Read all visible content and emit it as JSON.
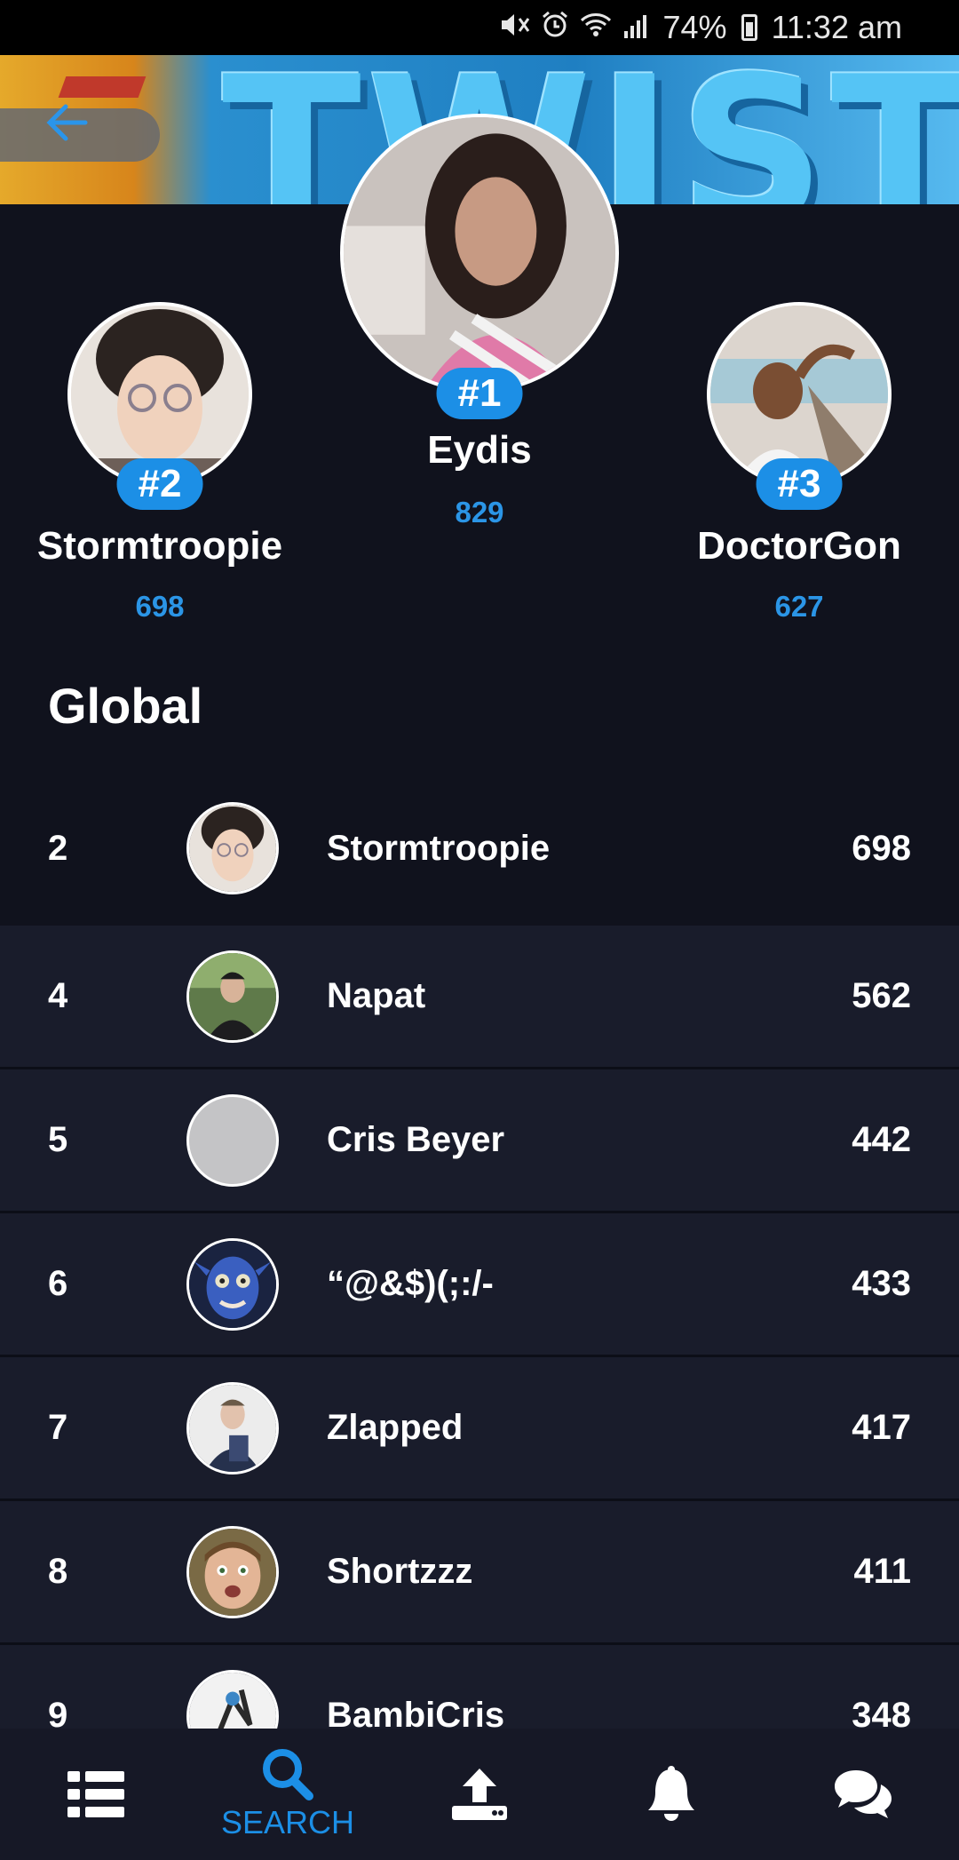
{
  "status_bar": {
    "battery": "74%",
    "time": "11:32 am"
  },
  "banner": {
    "text": "TWISTER"
  },
  "podium": [
    {
      "rank": "#1",
      "name": "Eydis",
      "score": "829"
    },
    {
      "rank": "#2",
      "name": "Stormtroopie",
      "score": "698"
    },
    {
      "rank": "#3",
      "name": "DoctorGon",
      "score": "627"
    }
  ],
  "global": {
    "title": "Global"
  },
  "rows": [
    {
      "rank": "2",
      "name": "Stormtroopie",
      "score": "698"
    },
    {
      "rank": "4",
      "name": "Napat",
      "score": "562"
    },
    {
      "rank": "5",
      "name": "Cris Beyer",
      "score": "442"
    },
    {
      "rank": "6",
      "name": "“@&$)(;:/-",
      "score": "433"
    },
    {
      "rank": "7",
      "name": "Zlapped",
      "score": "417"
    },
    {
      "rank": "8",
      "name": "Shortzzz",
      "score": "411"
    },
    {
      "rank": "9",
      "name": "BambiCris",
      "score": "348"
    }
  ],
  "nav": {
    "search_label": "SEARCH"
  },
  "colors": {
    "accent": "#1c8fe6",
    "background": "#10121d",
    "row_background": "#191c2b"
  }
}
